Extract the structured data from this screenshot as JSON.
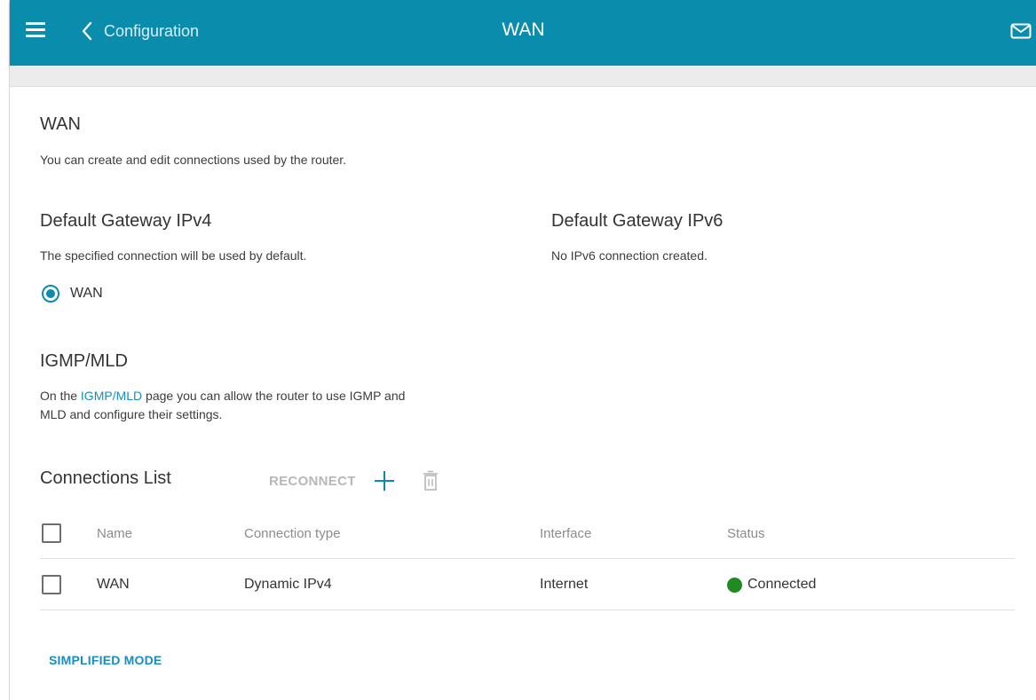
{
  "colors": {
    "accent": "#0a8cad",
    "link": "#1a8dc0",
    "status_connected": "#1e8c1e"
  },
  "header": {
    "menu_icon": "hamburger-menu-icon",
    "back_label": "Configuration",
    "title": "WAN",
    "mail_icon": "envelope-icon"
  },
  "page": {
    "title": "WAN",
    "description": "You can create and edit connections used by the router."
  },
  "gateway_ipv4": {
    "title": "Default Gateway IPv4",
    "description": "The specified connection will be used by default.",
    "option_label": "WAN",
    "selected": true
  },
  "gateway_ipv6": {
    "title": "Default Gateway IPv6",
    "description": "No IPv6 connection created."
  },
  "igmp": {
    "title": "IGMP/MLD",
    "text_before": "On the ",
    "link_label": "IGMP/MLD",
    "text_after": " page you can allow the router to use IGMP and",
    "text_line2": "MLD and configure their settings."
  },
  "connections": {
    "title": "Connections List",
    "reconnect_label": "RECONNECT",
    "add_icon": "plus-icon",
    "delete_icon": "trash-icon",
    "columns": [
      "Name",
      "Connection type",
      "Interface",
      "Status"
    ],
    "rows": [
      {
        "name": "WAN",
        "type": "Dynamic IPv4",
        "interface": "Internet",
        "status": "Connected",
        "checked": false
      }
    ]
  },
  "footer": {
    "simplified_mode_label": "SIMPLIFIED MODE"
  }
}
